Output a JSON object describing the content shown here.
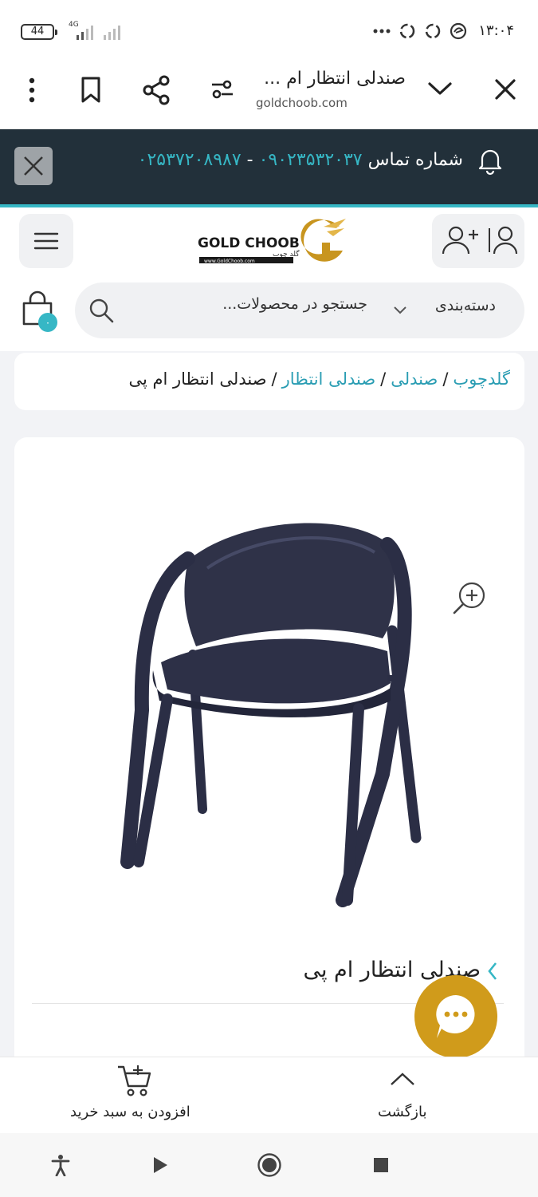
{
  "status_bar": {
    "battery": "44",
    "network": "4G",
    "time": "۱۳:۰۴"
  },
  "browser": {
    "page_title": "صندلی انتظار ام ...",
    "host": "goldchoob.com"
  },
  "notice": {
    "label": "شماره تماس",
    "phone_mobile": "۰۹۰۲۳۵۳۲۰۳۷",
    "separator": "-",
    "phone_landline": "۰۲۵۳۷۲۰۸۹۸۷"
  },
  "header": {
    "logo_text": "GOLD CHOOB",
    "logo_subtext": "گلد چوب",
    "logo_url_text": "www.GoldChoob.com"
  },
  "search": {
    "category_label": "دسته‌بندی",
    "placeholder": "جستجو در محصولات..."
  },
  "cart": {
    "count": "۰"
  },
  "breadcrumb": {
    "items": [
      "گلدچوب",
      "صندلی",
      "صندلی انتظار"
    ],
    "separator": "/",
    "current": "صندلی انتظار ام پی"
  },
  "product": {
    "title": "صندلی انتظار ام پی"
  },
  "bottom_bar": {
    "back_label": "بازگشت",
    "add_to_cart_label": "افزودن به سبد خرید"
  },
  "colors": {
    "accent": "#36b7c5",
    "notice_bg": "#22303a",
    "chat_button": "#d09b1b",
    "logo_gold": "#c8951f"
  },
  "icons": {
    "notice": "bell-icon",
    "menu": "hamburger-icon",
    "account": "user-add-icon",
    "search": "search-icon",
    "cart": "shopping-bag-icon",
    "zoom": "zoom-in-icon",
    "chat": "chat-bubble-icon"
  }
}
